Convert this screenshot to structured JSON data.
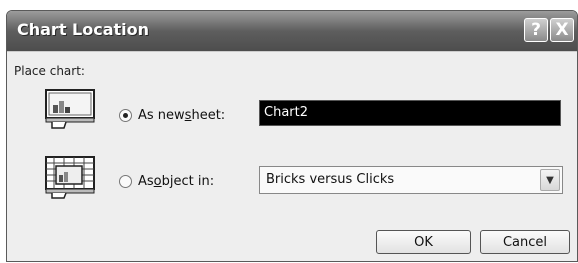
{
  "dialog": {
    "title": "Chart Location",
    "help_button": "?",
    "close_button": "X"
  },
  "place_chart": {
    "group_label": "Place chart:",
    "new_sheet": {
      "label_prefix": "As new ",
      "label_accel": "s",
      "label_suffix": "heet:",
      "selected": true,
      "value": "Chart2",
      "icon": "new-sheet-chart-icon"
    },
    "object_in": {
      "label_prefix": "As ",
      "label_accel": "o",
      "label_suffix": "bject in:",
      "selected": false,
      "value": "Bricks versus Clicks",
      "icon": "embedded-chart-icon"
    }
  },
  "buttons": {
    "ok_label": "OK",
    "cancel_label": "Cancel"
  }
}
